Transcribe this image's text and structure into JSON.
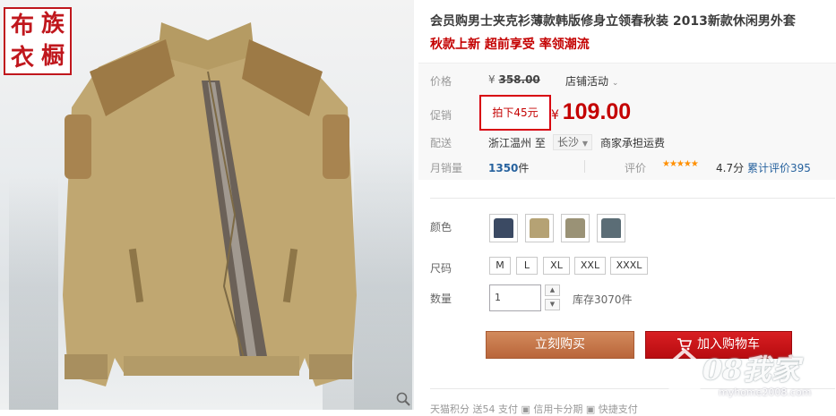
{
  "product": {
    "title": "会员购男士夹克衫薄款韩版修身立领春秋装 2013新款休闲男外套",
    "subtitle": "秋款上新 超前享受 率领潮流"
  },
  "brand_seal": {
    "chars": [
      "布",
      "族",
      "衣",
      "橱"
    ],
    "color": "#c0171d"
  },
  "pricing": {
    "price_label": "价格",
    "currency": "¥",
    "original_price": "358.00",
    "store_activity": "店铺活动",
    "promo_label": "促销",
    "promo_tag": "拍下45元",
    "promo_price": "109.00",
    "accent_color": "#c40000"
  },
  "delivery": {
    "label": "配送",
    "from": "浙江温州 至",
    "to": "长沙",
    "fee": "商家承担运费"
  },
  "sales": {
    "monthly_label": "月销量",
    "monthly_count": "1350",
    "monthly_unit": "件",
    "rating_label": "评价",
    "stars": "★★★★★",
    "score": "4.7分",
    "review_link": "累计评价395"
  },
  "sku": {
    "color_label": "颜色",
    "colors": [
      {
        "name": "navy",
        "hex": "#3b4a63"
      },
      {
        "name": "khaki",
        "hex": "#b5a274"
      },
      {
        "name": "olive",
        "hex": "#9a9276"
      },
      {
        "name": "slate",
        "hex": "#5b6d76"
      }
    ],
    "size_label": "尺码",
    "sizes": [
      "M",
      "L",
      "XL",
      "XXL",
      "XXXL"
    ]
  },
  "quantity": {
    "label": "数量",
    "value": "1",
    "stock": "库存3070件"
  },
  "actions": {
    "buy_now": "立刻购买",
    "add_to_cart": "加入购物车"
  },
  "footer_row": "天猫积分    送54                    支付  ▣ 信用卡分期  ▣ 快捷支付",
  "watermark": {
    "text": "08我家",
    "url": "myhome2008.com"
  }
}
